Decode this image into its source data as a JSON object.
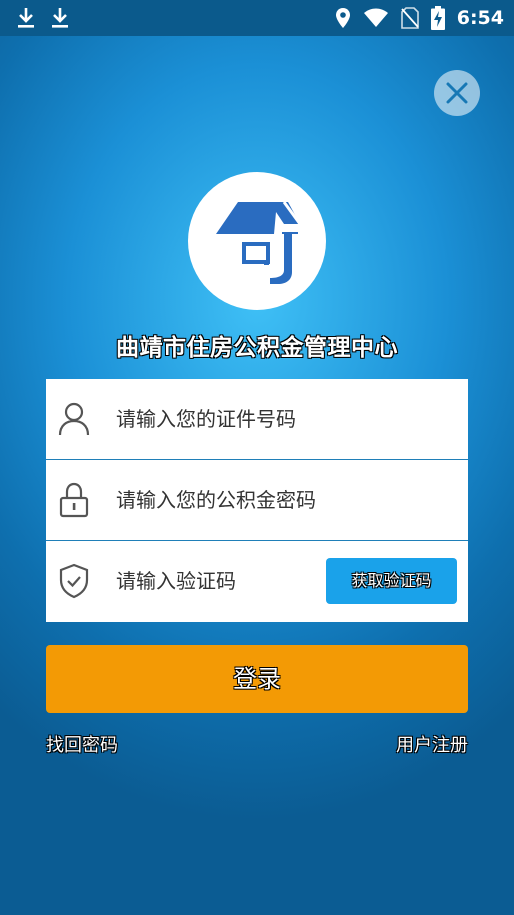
{
  "status_bar": {
    "time": "6:54",
    "icons": [
      "download-icon",
      "download-icon",
      "location-icon",
      "wifi-icon",
      "no-sim-icon",
      "battery-charging-icon"
    ]
  },
  "org_name": "曲靖市住房公积金管理中心",
  "form": {
    "id_placeholder": "请输入您的证件号码",
    "password_placeholder": "请输入您的公积金密码",
    "code_placeholder": "请输入验证码",
    "get_code_label": "获取验证码"
  },
  "login_label": "登录",
  "links": {
    "recover_password": "找回密码",
    "register": "用户注册"
  },
  "colors": {
    "primary_blue": "#1aa2ea",
    "login_orange": "#f39a05",
    "status_bar": "#0b5a8c"
  }
}
